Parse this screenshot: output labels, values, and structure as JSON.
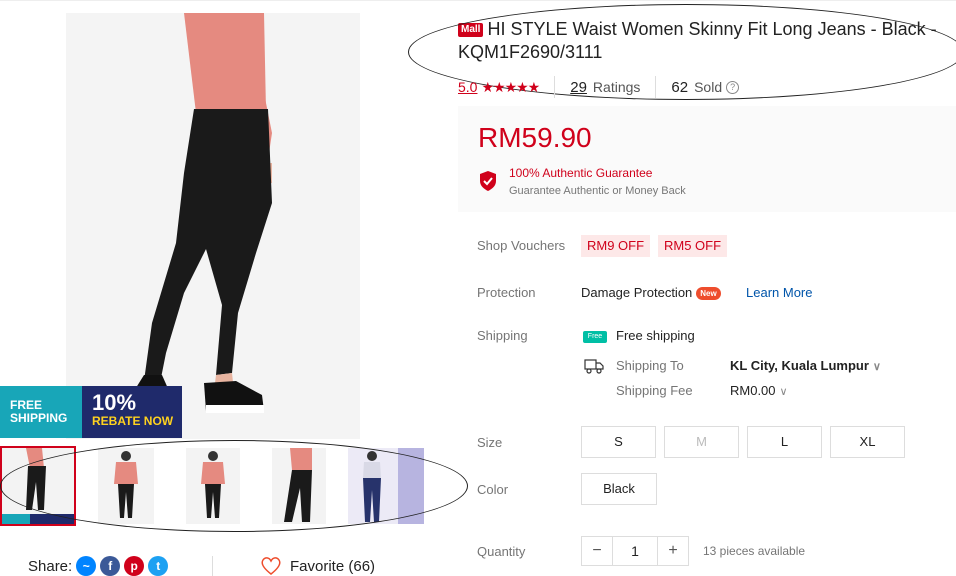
{
  "product": {
    "badge": "Mall",
    "title": "HI STYLE Waist Women Skinny Fit Long Jeans - Black - KQM1F2690/3111",
    "rating": "5.0",
    "stars": "★★★★★",
    "ratings_count": "29",
    "ratings_label": "Ratings",
    "sold_count": "62",
    "sold_label": "Sold",
    "help_icon": "?"
  },
  "promo": {
    "free_line1": "FREE",
    "free_line2": "SHIPPING",
    "rebate_pct": "10%",
    "rebate_text": "REBATE NOW"
  },
  "price": {
    "value": "RM59.90",
    "guarantee_title": "100% Authentic Guarantee",
    "guarantee_sub": "Guarantee Authentic or Money Back"
  },
  "vouchers": {
    "label": "Shop Vouchers",
    "items": [
      "RM9 OFF",
      "RM5 OFF"
    ]
  },
  "protection": {
    "label": "Protection",
    "value": "Damage Protection",
    "new_badge": "New",
    "learn_more": "Learn More"
  },
  "shipping": {
    "label": "Shipping",
    "free_icon": "Free",
    "free_text": "Free shipping",
    "to_label": "Shipping To",
    "to_value": "KL City, Kuala Lumpur",
    "fee_label": "Shipping Fee",
    "fee_value": "RM0.00"
  },
  "size": {
    "label": "Size",
    "options": [
      "S",
      "M",
      "L",
      "XL"
    ]
  },
  "color": {
    "label": "Color",
    "options": [
      "Black"
    ]
  },
  "quantity": {
    "label": "Quantity",
    "minus": "−",
    "value": "1",
    "plus": "+",
    "available": "13 pieces available"
  },
  "footer": {
    "share_label": "Share:",
    "favorite": "Favorite (66)"
  },
  "colors": {
    "accent": "#d0011b",
    "link": "#0055aa",
    "free_green": "#00bfa5"
  }
}
